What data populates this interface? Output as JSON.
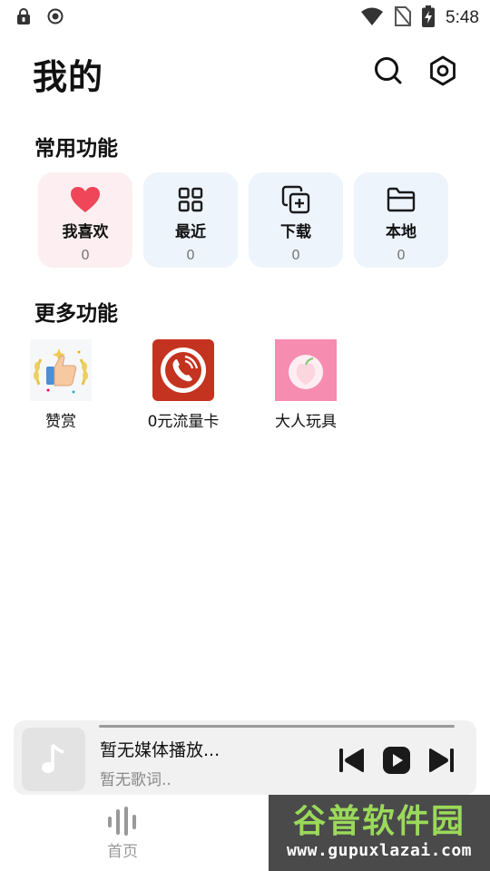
{
  "status_bar": {
    "time": "5:48",
    "icons": [
      "lock-icon",
      "record-icon",
      "wifi-icon",
      "no-sim-icon",
      "battery-charging-icon"
    ]
  },
  "header": {
    "title": "我的",
    "actions": [
      "search-icon",
      "settings-icon"
    ]
  },
  "common": {
    "title": "常用功能",
    "items": [
      {
        "label": "我喜欢",
        "count": "0",
        "icon": "heart-icon",
        "bg": "#fdeff1",
        "icon_color": "#f0465a"
      },
      {
        "label": "最近",
        "count": "0",
        "icon": "grid-icon",
        "bg": "#edf4fc",
        "icon_color": "#1a1a1a"
      },
      {
        "label": "下载",
        "count": "0",
        "icon": "add-copy-icon",
        "bg": "#edf4fc",
        "icon_color": "#1a1a1a"
      },
      {
        "label": "本地",
        "count": "0",
        "icon": "folder-icon",
        "bg": "#edf4fc",
        "icon_color": "#1a1a1a"
      }
    ]
  },
  "more": {
    "title": "更多功能",
    "items": [
      {
        "label": "赞赏",
        "icon": "thumbs-up-icon"
      },
      {
        "label": "0元流量卡",
        "icon": "phone-call-icon"
      },
      {
        "label": "大人玩具",
        "icon": "peach-icon"
      }
    ]
  },
  "player": {
    "title": "暂无媒体播放...",
    "subtitle": "暂无歌词..",
    "controls": [
      "previous-icon",
      "play-icon",
      "next-icon"
    ]
  },
  "bottom_nav": {
    "home_label": "首页"
  },
  "watermark": {
    "main": "谷普软件园",
    "url": "www.gupuxlazai.com"
  },
  "colors": {
    "accent_red": "#f0465a",
    "card_blue": "#edf4fc",
    "card_pink": "#fdeff1"
  }
}
